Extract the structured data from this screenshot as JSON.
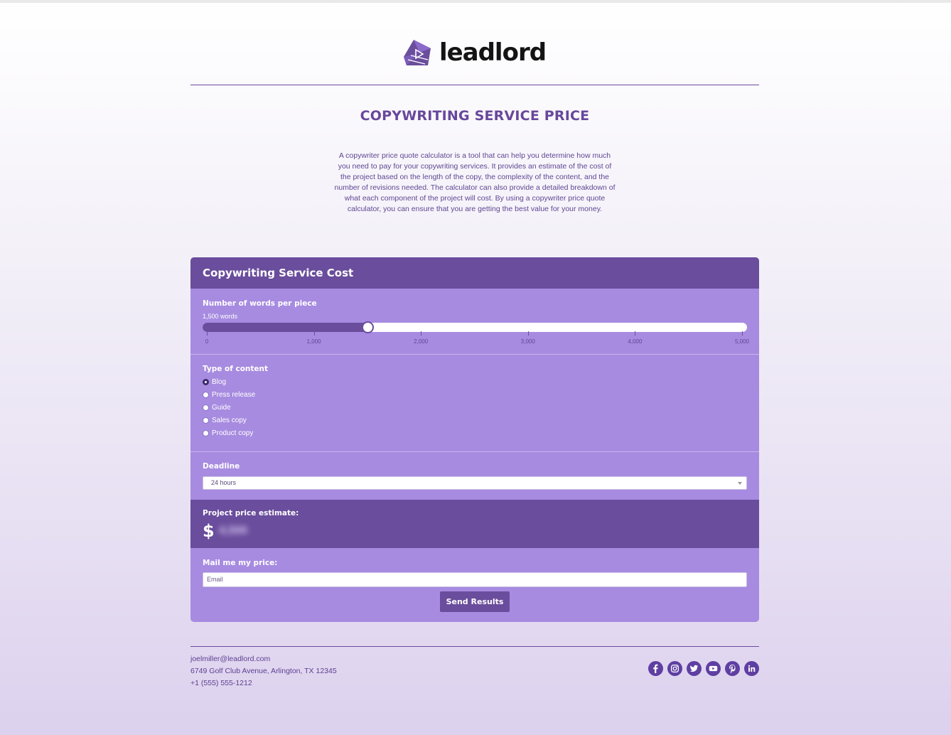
{
  "brand": {
    "name": "leadlord",
    "accent": "#6a4d9c",
    "panel": "#a78be0"
  },
  "page": {
    "title": "COPYWRITING SERVICE PRICE",
    "description": "A copywriter price quote calculator is a tool that can help you determine how much you need to pay for your copywriting services. It provides an estimate of the cost of the project based on the length of the copy, the complexity of the content, and the number of revisions needed. The calculator can also provide a detailed breakdown of what each component of the project will cost. By using a copywriter price quote calculator, you can ensure that you are getting the best value for your money."
  },
  "calculator": {
    "title": "Copywriting Service Cost",
    "words": {
      "label": "Number of words per piece",
      "value_text": "1,500 words",
      "value": 1500,
      "min": 0,
      "max": 5000,
      "ticks": [
        "0",
        "1,000",
        "2,000",
        "3,000",
        "4,000",
        "5,000"
      ]
    },
    "content_type": {
      "label": "Type of content",
      "options": [
        "Blog",
        "Press release",
        "Guide",
        "Sales copy",
        "Product copy"
      ],
      "selected_index": 0
    },
    "deadline": {
      "label": "Deadline",
      "value": "24 hours"
    },
    "estimate": {
      "label": "Project price estimate:",
      "currency": "$",
      "value": "4,500"
    },
    "mail": {
      "label": "Mail me my price:",
      "placeholder": "Email",
      "button": "Send Results"
    }
  },
  "footer": {
    "email": "joelmiller@leadlord.com",
    "address": "6749 Golf Club Avenue, Arlington, TX 12345",
    "phone": "+1 (555) 555-1212",
    "socials": [
      "facebook-icon",
      "instagram-icon",
      "twitter-icon",
      "youtube-icon",
      "pinterest-icon",
      "linkedin-icon"
    ]
  }
}
